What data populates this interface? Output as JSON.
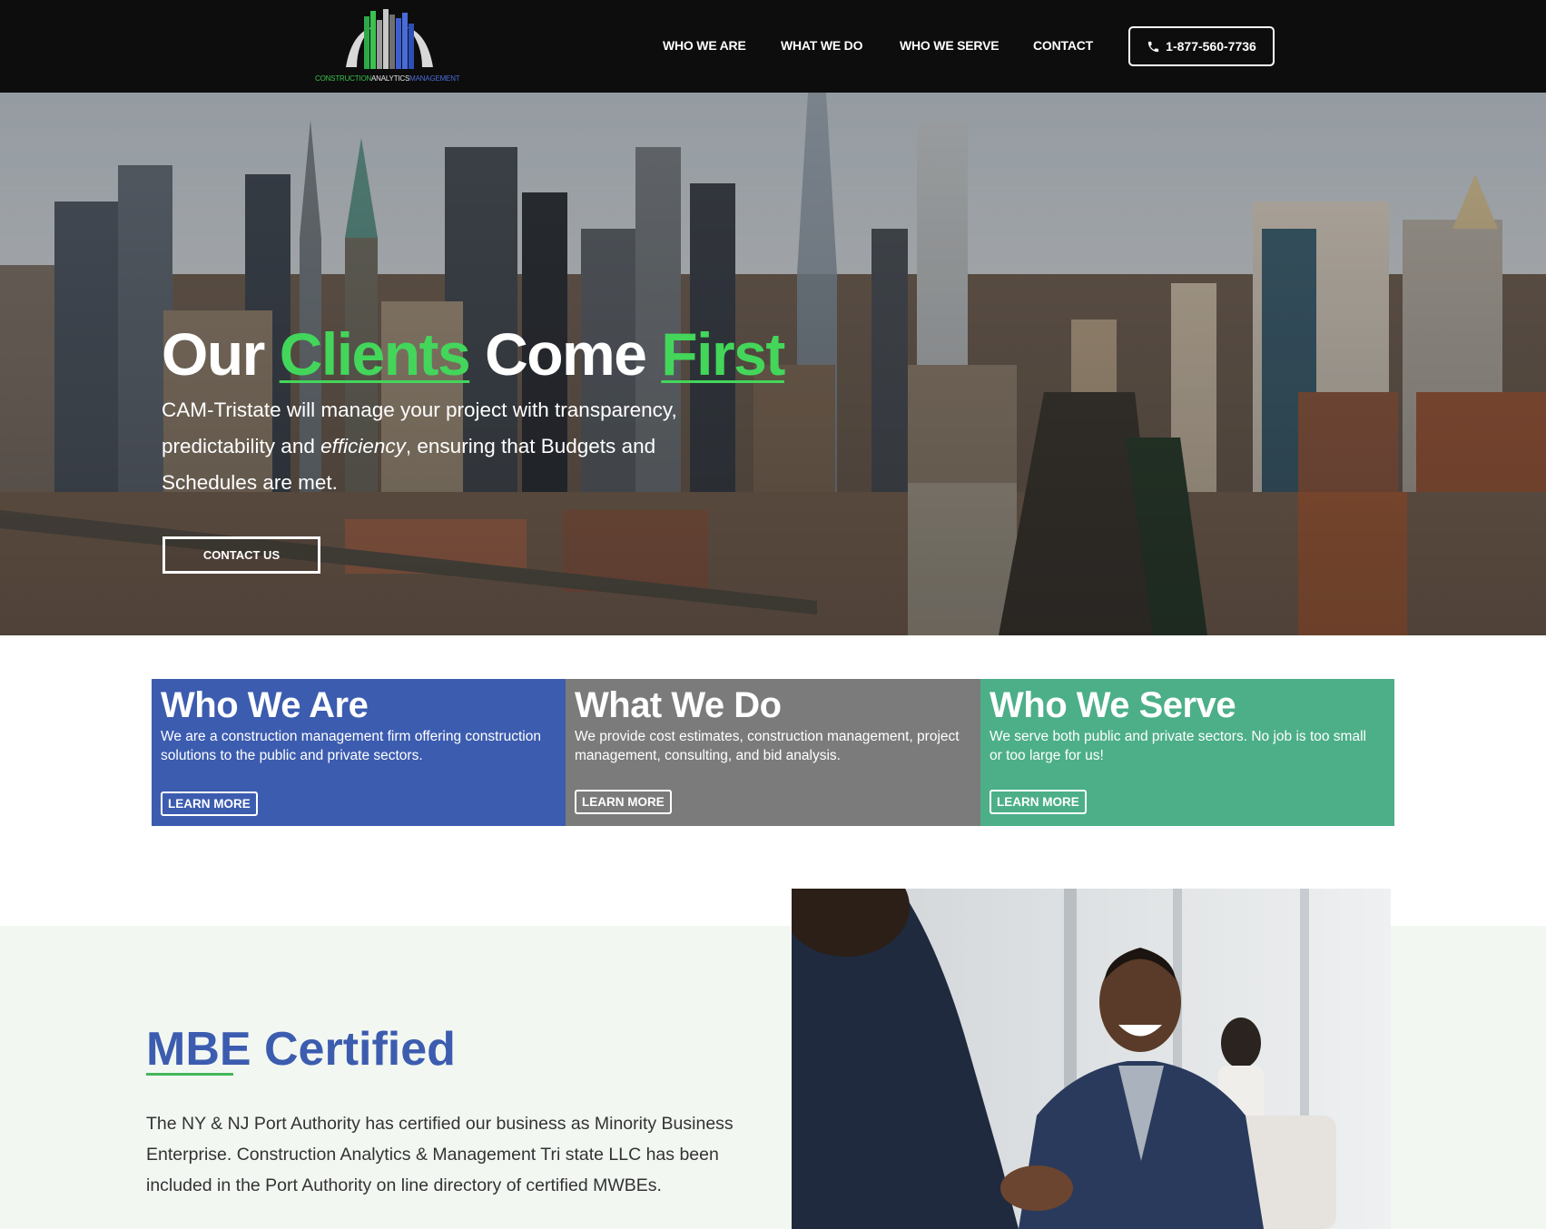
{
  "header": {
    "logo": {
      "text_parts": [
        "CONSTRUCTION",
        "ANALYTICS",
        "MANAGEMENT"
      ],
      "colors": {
        "green": "#3ac24f",
        "white": "#e8e8e8",
        "blue": "#4a6cd8"
      }
    },
    "nav": [
      {
        "label": "WHO WE ARE"
      },
      {
        "label": "WHAT WE DO"
      },
      {
        "label": "WHO WE SERVE"
      },
      {
        "label": "CONTACT"
      }
    ],
    "phone": {
      "label": "1-877-560-7736",
      "icon": "phone-icon"
    }
  },
  "hero": {
    "title": {
      "w1": "Our",
      "w2": "Clients",
      "w3": "Come",
      "w4": "First"
    },
    "subtitle": {
      "part1": "CAM-Tristate will manage your project with transparency, predictability and ",
      "emphasis": "efficiency",
      "part2": ", ensuring that Budgets and Schedules are met."
    },
    "cta": "CONTACT US",
    "accent_color": "#43d65a"
  },
  "features": [
    {
      "title": "Who We Are",
      "description": "We are a construction management firm offering construction solutions to the public and private sectors.",
      "button": "LEARN MORE",
      "color": "#3c5caf"
    },
    {
      "title": "What We Do",
      "description": "We provide cost estimates, construction management, project management, consulting, and bid analysis.",
      "button": "LEARN MORE",
      "color": "#7b7b7b"
    },
    {
      "title": "Who We Serve",
      "description": "We serve both public and private sectors. No job is too small or too large for us!",
      "button": "LEARN MORE",
      "color": "#4caf88"
    }
  ],
  "mbe": {
    "title": "MBE Certified",
    "body": "The NY & NJ Port Authority has certified our business as Minority Business Enterprise.  Construction Analytics & Management Tri state LLC has been included in the Port Authority on line directory of certified MWBEs.",
    "title_color": "#3c5caf"
  }
}
